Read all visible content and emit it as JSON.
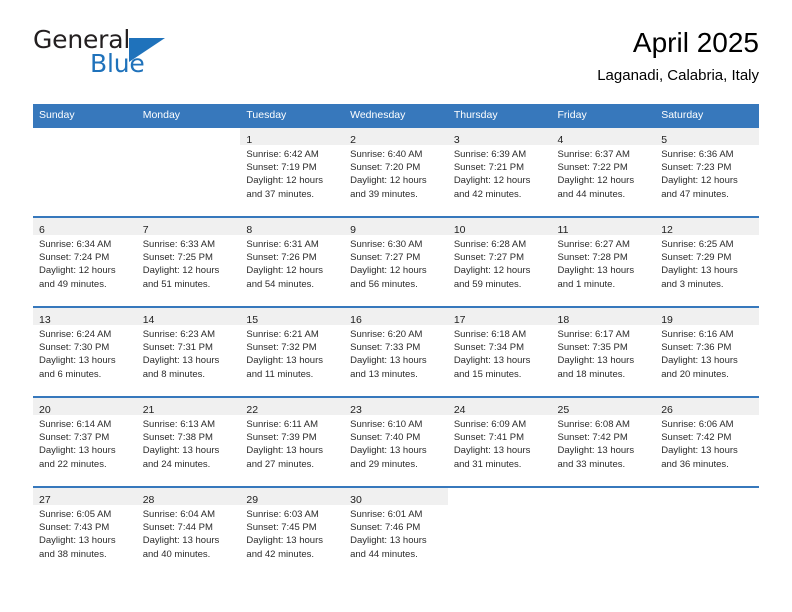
{
  "brand": {
    "name_top": "General",
    "name_bottom": "Blue",
    "triangle_icon": "blue-triangle-logo",
    "accent_color": "#1f72bb"
  },
  "header": {
    "month_title": "April 2025",
    "location": "Laganadi, Calabria, Italy"
  },
  "calendar": {
    "header_bg": "#3778bc",
    "row_divider_color": "#3778bc",
    "daynum_band_bg": "#f0f0f0",
    "weekdays": [
      "Sunday",
      "Monday",
      "Tuesday",
      "Wednesday",
      "Thursday",
      "Friday",
      "Saturday"
    ],
    "weeks": [
      [
        {
          "day": "",
          "lines": []
        },
        {
          "day": "",
          "lines": []
        },
        {
          "day": "1",
          "lines": [
            "Sunrise: 6:42 AM",
            "Sunset: 7:19 PM",
            "Daylight: 12 hours",
            "and 37 minutes."
          ]
        },
        {
          "day": "2",
          "lines": [
            "Sunrise: 6:40 AM",
            "Sunset: 7:20 PM",
            "Daylight: 12 hours",
            "and 39 minutes."
          ]
        },
        {
          "day": "3",
          "lines": [
            "Sunrise: 6:39 AM",
            "Sunset: 7:21 PM",
            "Daylight: 12 hours",
            "and 42 minutes."
          ]
        },
        {
          "day": "4",
          "lines": [
            "Sunrise: 6:37 AM",
            "Sunset: 7:22 PM",
            "Daylight: 12 hours",
            "and 44 minutes."
          ]
        },
        {
          "day": "5",
          "lines": [
            "Sunrise: 6:36 AM",
            "Sunset: 7:23 PM",
            "Daylight: 12 hours",
            "and 47 minutes."
          ]
        }
      ],
      [
        {
          "day": "6",
          "lines": [
            "Sunrise: 6:34 AM",
            "Sunset: 7:24 PM",
            "Daylight: 12 hours",
            "and 49 minutes."
          ]
        },
        {
          "day": "7",
          "lines": [
            "Sunrise: 6:33 AM",
            "Sunset: 7:25 PM",
            "Daylight: 12 hours",
            "and 51 minutes."
          ]
        },
        {
          "day": "8",
          "lines": [
            "Sunrise: 6:31 AM",
            "Sunset: 7:26 PM",
            "Daylight: 12 hours",
            "and 54 minutes."
          ]
        },
        {
          "day": "9",
          "lines": [
            "Sunrise: 6:30 AM",
            "Sunset: 7:27 PM",
            "Daylight: 12 hours",
            "and 56 minutes."
          ]
        },
        {
          "day": "10",
          "lines": [
            "Sunrise: 6:28 AM",
            "Sunset: 7:27 PM",
            "Daylight: 12 hours",
            "and 59 minutes."
          ]
        },
        {
          "day": "11",
          "lines": [
            "Sunrise: 6:27 AM",
            "Sunset: 7:28 PM",
            "Daylight: 13 hours",
            "and 1 minute."
          ]
        },
        {
          "day": "12",
          "lines": [
            "Sunrise: 6:25 AM",
            "Sunset: 7:29 PM",
            "Daylight: 13 hours",
            "and 3 minutes."
          ]
        }
      ],
      [
        {
          "day": "13",
          "lines": [
            "Sunrise: 6:24 AM",
            "Sunset: 7:30 PM",
            "Daylight: 13 hours",
            "and 6 minutes."
          ]
        },
        {
          "day": "14",
          "lines": [
            "Sunrise: 6:23 AM",
            "Sunset: 7:31 PM",
            "Daylight: 13 hours",
            "and 8 minutes."
          ]
        },
        {
          "day": "15",
          "lines": [
            "Sunrise: 6:21 AM",
            "Sunset: 7:32 PM",
            "Daylight: 13 hours",
            "and 11 minutes."
          ]
        },
        {
          "day": "16",
          "lines": [
            "Sunrise: 6:20 AM",
            "Sunset: 7:33 PM",
            "Daylight: 13 hours",
            "and 13 minutes."
          ]
        },
        {
          "day": "17",
          "lines": [
            "Sunrise: 6:18 AM",
            "Sunset: 7:34 PM",
            "Daylight: 13 hours",
            "and 15 minutes."
          ]
        },
        {
          "day": "18",
          "lines": [
            "Sunrise: 6:17 AM",
            "Sunset: 7:35 PM",
            "Daylight: 13 hours",
            "and 18 minutes."
          ]
        },
        {
          "day": "19",
          "lines": [
            "Sunrise: 6:16 AM",
            "Sunset: 7:36 PM",
            "Daylight: 13 hours",
            "and 20 minutes."
          ]
        }
      ],
      [
        {
          "day": "20",
          "lines": [
            "Sunrise: 6:14 AM",
            "Sunset: 7:37 PM",
            "Daylight: 13 hours",
            "and 22 minutes."
          ]
        },
        {
          "day": "21",
          "lines": [
            "Sunrise: 6:13 AM",
            "Sunset: 7:38 PM",
            "Daylight: 13 hours",
            "and 24 minutes."
          ]
        },
        {
          "day": "22",
          "lines": [
            "Sunrise: 6:11 AM",
            "Sunset: 7:39 PM",
            "Daylight: 13 hours",
            "and 27 minutes."
          ]
        },
        {
          "day": "23",
          "lines": [
            "Sunrise: 6:10 AM",
            "Sunset: 7:40 PM",
            "Daylight: 13 hours",
            "and 29 minutes."
          ]
        },
        {
          "day": "24",
          "lines": [
            "Sunrise: 6:09 AM",
            "Sunset: 7:41 PM",
            "Daylight: 13 hours",
            "and 31 minutes."
          ]
        },
        {
          "day": "25",
          "lines": [
            "Sunrise: 6:08 AM",
            "Sunset: 7:42 PM",
            "Daylight: 13 hours",
            "and 33 minutes."
          ]
        },
        {
          "day": "26",
          "lines": [
            "Sunrise: 6:06 AM",
            "Sunset: 7:42 PM",
            "Daylight: 13 hours",
            "and 36 minutes."
          ]
        }
      ],
      [
        {
          "day": "27",
          "lines": [
            "Sunrise: 6:05 AM",
            "Sunset: 7:43 PM",
            "Daylight: 13 hours",
            "and 38 minutes."
          ]
        },
        {
          "day": "28",
          "lines": [
            "Sunrise: 6:04 AM",
            "Sunset: 7:44 PM",
            "Daylight: 13 hours",
            "and 40 minutes."
          ]
        },
        {
          "day": "29",
          "lines": [
            "Sunrise: 6:03 AM",
            "Sunset: 7:45 PM",
            "Daylight: 13 hours",
            "and 42 minutes."
          ]
        },
        {
          "day": "30",
          "lines": [
            "Sunrise: 6:01 AM",
            "Sunset: 7:46 PM",
            "Daylight: 13 hours",
            "and 44 minutes."
          ]
        },
        {
          "day": "",
          "lines": []
        },
        {
          "day": "",
          "lines": []
        },
        {
          "day": "",
          "lines": []
        }
      ]
    ]
  }
}
